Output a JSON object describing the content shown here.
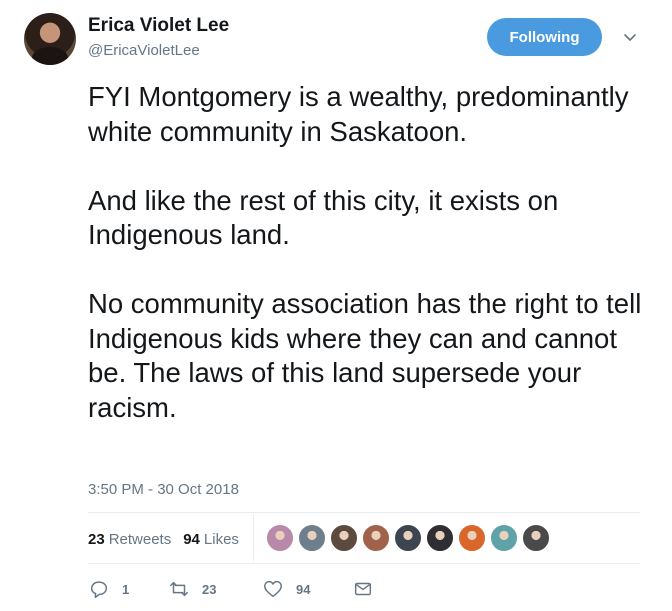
{
  "author": {
    "name": "Erica Violet Lee",
    "handle": "@EricaVioletLee",
    "avatar_icon": "profile-photo"
  },
  "follow_button": {
    "label": "Following",
    "color": "#4a9ae0"
  },
  "tweet": {
    "text": "FYI Montgomery is a wealthy, predominantly white community in Saskatoon.\n\nAnd like the rest of this city, it exists on Indigenous land.\n\nNo community association has the right to tell Indigenous kids where they can and cannot be. The laws of this land supersede your racism.",
    "timestamp": "3:50 PM - 30 Oct 2018"
  },
  "stats": {
    "retweets_count": "23",
    "retweets_label": "Retweets",
    "likes_count": "94",
    "likes_label": "Likes"
  },
  "likers": [
    {
      "icon": "liker-avatar",
      "color": "#b889a8"
    },
    {
      "icon": "liker-avatar",
      "color": "#6d7f8c"
    },
    {
      "icon": "liker-avatar",
      "color": "#5b4a3f"
    },
    {
      "icon": "liker-avatar",
      "color": "#a0624a"
    },
    {
      "icon": "liker-avatar",
      "color": "#3d4650"
    },
    {
      "icon": "liker-avatar",
      "color": "#2f2f33"
    },
    {
      "icon": "liker-avatar",
      "color": "#d9662b"
    },
    {
      "icon": "liker-avatar",
      "color": "#5fa3a8"
    },
    {
      "icon": "liker-avatar",
      "color": "#4a4a4a"
    }
  ],
  "actions": {
    "reply_count": "1",
    "retweet_count": "23",
    "like_count": "94"
  }
}
